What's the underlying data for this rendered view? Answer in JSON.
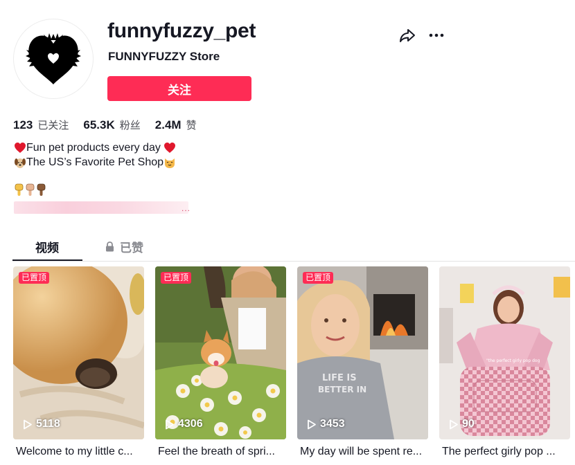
{
  "profile": {
    "username": "funnyfuzzy_pet",
    "nickname": "FUNNYFUZZY Store",
    "follow_label": "关注"
  },
  "stats": [
    {
      "value": "123",
      "label": "已关注"
    },
    {
      "value": "65.3K",
      "label": "粉丝"
    },
    {
      "value": "2.4M",
      "label": "赞"
    }
  ],
  "bio": {
    "line1": "Fun pet products every day",
    "line2": "The US’s Favorite Pet Shop"
  },
  "tabs": {
    "videos": "视频",
    "liked": "已赞"
  },
  "videos": [
    {
      "pinned": "已置顶",
      "views": "5118",
      "caption": "Welcome to my little c..."
    },
    {
      "pinned": "已置顶",
      "views": "4306",
      "caption": "Feel the breath of spri..."
    },
    {
      "pinned": "已置顶",
      "views": "3453",
      "caption": "My day will be spent re..."
    },
    {
      "pinned": "",
      "views": "90",
      "caption": "The perfect girly pop ..."
    }
  ],
  "icons": {
    "share": "share-icon",
    "more": "more-icon",
    "lock": "lock-icon",
    "play": "play-icon"
  },
  "colors": {
    "accent": "#fe2c55",
    "text": "#161823",
    "muted": "#8a8b91"
  }
}
